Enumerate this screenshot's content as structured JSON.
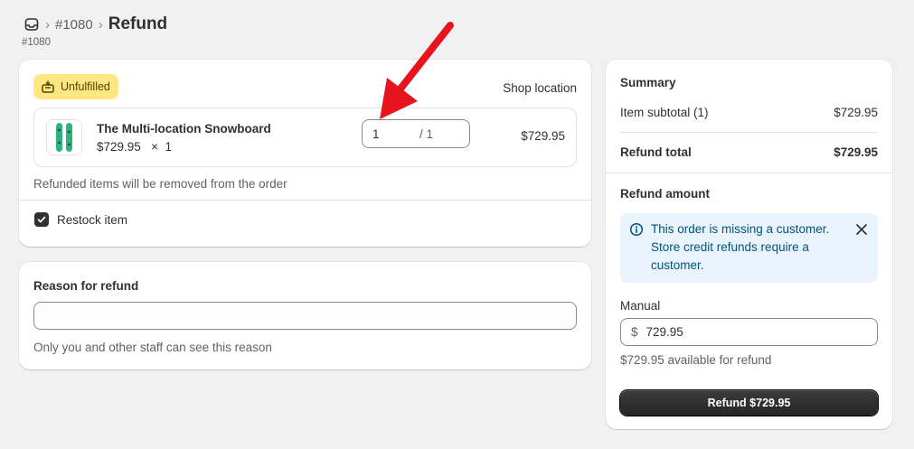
{
  "breadcrumb": {
    "order_crumb": "#1080",
    "title": "Refund",
    "sub_id": "#1080"
  },
  "icons": {
    "home": "inbox-icon",
    "badge": "unfulfilled-icon",
    "info": "info-icon",
    "close": "close-icon",
    "check": "check-icon"
  },
  "line_items": {
    "badge": "Unfulfilled",
    "location": "Shop location",
    "item": {
      "name": "The Multi-location Snowboard",
      "unit_price": "$729.95",
      "times": "×",
      "quantity": "1",
      "refund_qty": "1",
      "max_qty": "/ 1",
      "line_total": "$729.95"
    },
    "note": "Refunded items will be removed from the order",
    "restock_label": "Restock item",
    "restock_checked": true
  },
  "reason": {
    "title": "Reason for refund",
    "value": "",
    "help": "Only you and other staff can see this reason"
  },
  "summary": {
    "title": "Summary",
    "subtotal_label": "Item subtotal (1)",
    "subtotal_value": "$729.95",
    "total_label": "Refund total",
    "total_value": "$729.95",
    "refund_amount_title": "Refund amount",
    "banner_text": "This order is missing a customer. Store credit refunds require a customer.",
    "manual_label": "Manual",
    "currency": "$",
    "manual_value": "729.95",
    "available": "$729.95 available for refund",
    "refund_button": "Refund $729.95"
  },
  "colors": {
    "badge_bg": "#ffe680",
    "banner_bg": "#eaf4ff",
    "annotation_arrow": "#e8141d"
  }
}
